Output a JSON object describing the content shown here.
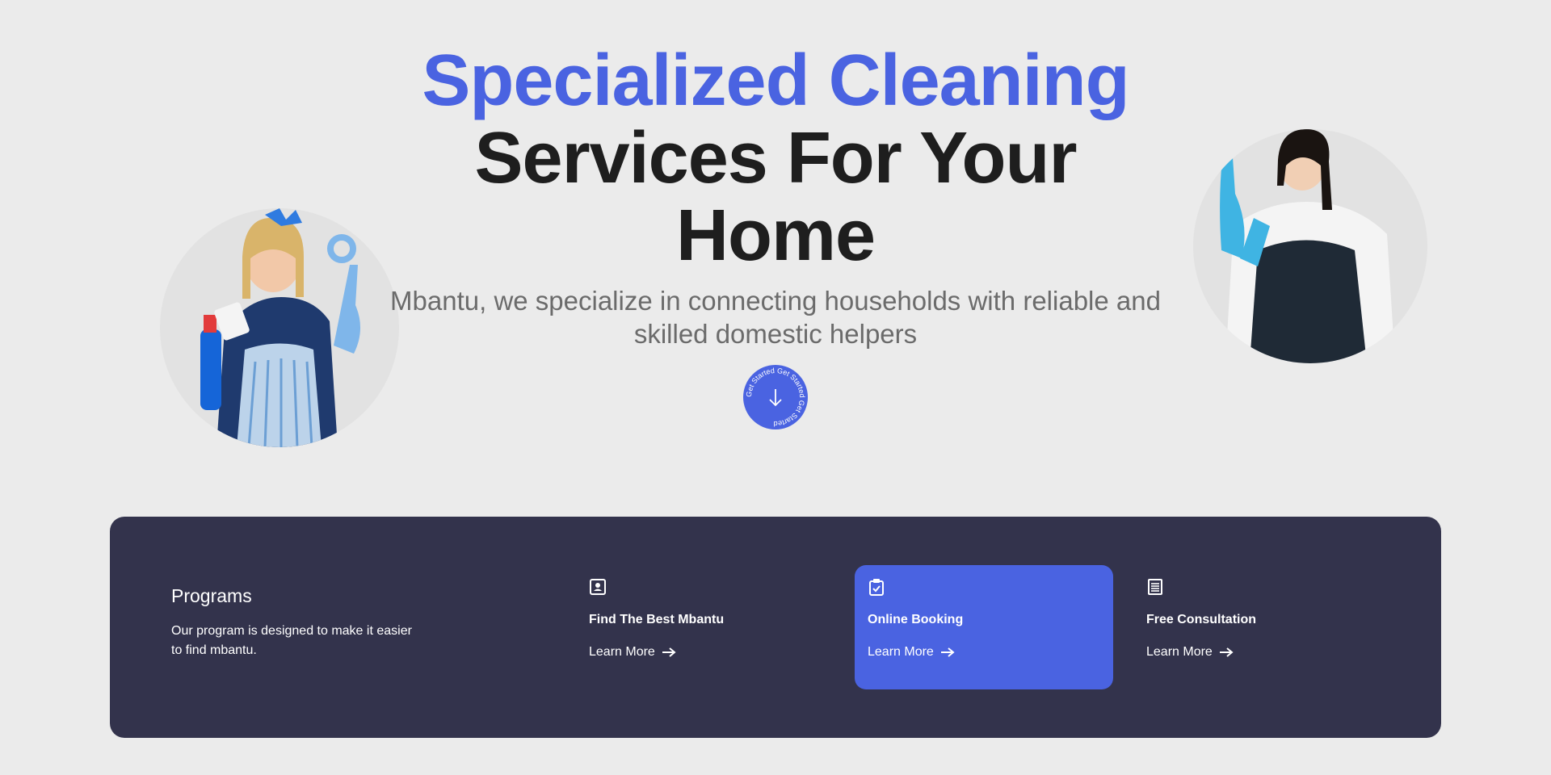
{
  "hero": {
    "title_accent": "Specialized Cleaning",
    "title_line2": "Services For Your",
    "title_line3": "Home",
    "subtitle_line1": "Mbantu, we specialize in connecting households with reliable and",
    "subtitle_line2": "skilled domestic helpers",
    "cta_ring_text": "Get Started Get Started Get Started",
    "cta_icon": "arrow-down-icon"
  },
  "programs": {
    "title": "Programs",
    "description_line1": "Our program is designed to make it easier",
    "description_line2": "to find mbantu.",
    "cards": [
      {
        "title": "Find The Best Mbantu",
        "link": "Learn More",
        "icon": "contact-card-icon"
      },
      {
        "title": "Online Booking",
        "link": "Learn More",
        "icon": "clipboard-check-icon"
      },
      {
        "title": "Free Consultation",
        "link": "Learn More",
        "icon": "document-list-icon"
      }
    ]
  },
  "colors": {
    "accent": "#4a63e1",
    "dark_text": "#1e1e1e",
    "panel": "#33334c",
    "background": "#ebebeb"
  }
}
